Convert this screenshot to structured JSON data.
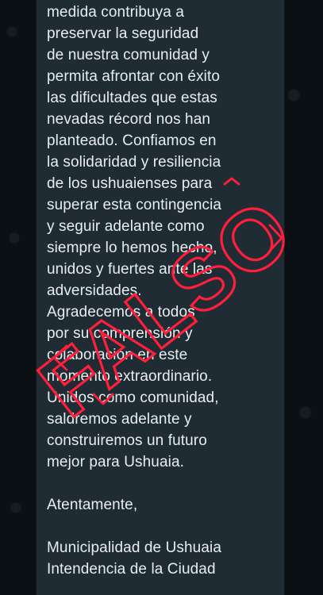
{
  "message": {
    "body": "medida contribuya a\npreservar la seguridad\nde nuestra comunidad y\npermita afrontar con éxito\nlas dificultades que estas\nnevadas récord nos han\nplanteado. Confiamos en\nla solidaridad y resiliencia\nde los ushuaienses para\nsuperar esta contingencia\ny seguir adelante como\nsiempre lo hemos hecho,\nunidos y fuertes ante las\nadversidades.\nAgradecemos a todos\npor su comprensión y\ncolaboración en este\nmomento extraordinario.\nUnidos como comunidad,\nsaldremos adelante y\nconstruiremos un futuro\nmejor para Ushuaia.\n\nAtentamente,\n\nMunicipalidad de Ushuaia\nIntendencia de la Ciudad"
  },
  "stamp": {
    "label": "FALSO",
    "color": "#ff1f3d"
  },
  "colors": {
    "background": "#0b1014",
    "bubble": "#1f2c33",
    "text": "#e9edef"
  }
}
